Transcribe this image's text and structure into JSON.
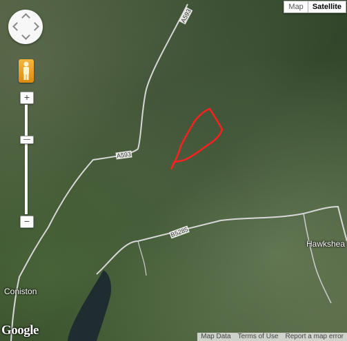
{
  "map_type": {
    "map_label": "Map",
    "satellite_label": "Satellite",
    "selected": "Satellite"
  },
  "zoom": {
    "in_label": "+",
    "out_label": "−"
  },
  "roads": {
    "a593_north": "A593",
    "a593_mid": "A593",
    "b5285": "B5285"
  },
  "places": {
    "coniston": "Coniston",
    "hawkshead": "Hawkshea"
  },
  "attribution": {
    "map_data": "Map Data",
    "terms": "Terms of Use",
    "report": "Report a map error"
  },
  "logo": "Google",
  "icons": [
    "pan-control",
    "pegman-icon",
    "zoom-slider"
  ],
  "colors": {
    "route": "#ff1f1f",
    "road": "#e0e0e0",
    "water": "#1f2c30"
  }
}
